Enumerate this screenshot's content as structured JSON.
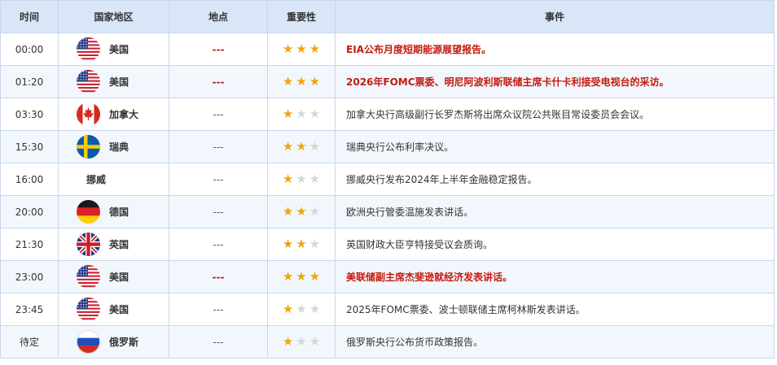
{
  "header": {
    "time": "时间",
    "country": "国家地区",
    "location": "地点",
    "importance": "重要性",
    "event": "事件"
  },
  "colors": {
    "header_bg": "#d8e6f8",
    "alt_row_bg": "#f2f7fd",
    "border": "#c9d6ea",
    "highlight_red": "#c41a0f",
    "star_on": "#f2a40a",
    "star_off": "#d6d6d6"
  },
  "rows": [
    {
      "time": "00:00",
      "flag": "us-flag-icon",
      "country": "美国",
      "location": "---",
      "stars": 3,
      "event": "EIA公布月度短期能源展望报告。",
      "highlight": true
    },
    {
      "time": "01:20",
      "flag": "us-flag-icon",
      "country": "美国",
      "location": "---",
      "stars": 3,
      "event": "2026年FOMC票委、明尼阿波利斯联储主席卡什卡利接受电视台的采访。",
      "highlight": true
    },
    {
      "time": "03:30",
      "flag": "canada-flag-icon",
      "country": "加拿大",
      "location": "---",
      "stars": 1,
      "event": "加拿大央行高级副行长罗杰斯将出席众议院公共账目常设委员会会议。",
      "highlight": false
    },
    {
      "time": "15:30",
      "flag": "sweden-flag-icon",
      "country": "瑞典",
      "location": "---",
      "stars": 2,
      "event": "瑞典央行公布利率决议。",
      "highlight": false
    },
    {
      "time": "16:00",
      "flag": "",
      "country": "挪威",
      "location": "---",
      "stars": 1,
      "event": "挪威央行发布2024年上半年金融稳定报告。",
      "highlight": false
    },
    {
      "time": "20:00",
      "flag": "germany-flag-icon",
      "country": "德国",
      "location": "---",
      "stars": 2,
      "event": "欧洲央行管委温施发表讲话。",
      "highlight": false
    },
    {
      "time": "21:30",
      "flag": "uk-flag-icon",
      "country": "英国",
      "location": "---",
      "stars": 2,
      "event": "英国财政大臣亨特接受议会质询。",
      "highlight": false
    },
    {
      "time": "23:00",
      "flag": "us-flag-icon",
      "country": "美国",
      "location": "---",
      "stars": 3,
      "event": "美联储副主席杰斐逊就经济发表讲话。",
      "highlight": true
    },
    {
      "time": "23:45",
      "flag": "us-flag-icon",
      "country": "美国",
      "location": "---",
      "stars": 1,
      "event": "2025年FOMC票委、波士顿联储主席柯林斯发表讲话。",
      "highlight": false
    },
    {
      "time": "待定",
      "flag": "russia-flag-icon",
      "country": "俄罗斯",
      "location": "---",
      "stars": 1,
      "event": "俄罗斯央行公布货币政策报告。",
      "highlight": false
    }
  ]
}
